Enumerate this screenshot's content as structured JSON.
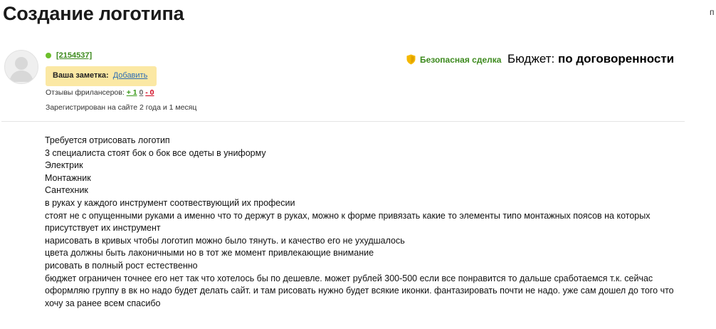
{
  "page": {
    "title": "Создание логотипа",
    "edge_text": "п"
  },
  "author": {
    "id_text": "[2154537]",
    "note_label": "Ваша заметка:",
    "note_link": "Добавить",
    "reviews_label": "Отзывы фрилансеров:",
    "reviews_positive": "+ 1",
    "reviews_neutral": "0",
    "reviews_negative": "- 0",
    "reviews_sep": "-",
    "registered": "Зарегистрирован на сайте 2 года и 1 месяц"
  },
  "deal": {
    "safe_deal_label": "Безопасная сделка",
    "budget_label": "Бюджет:",
    "budget_value": "по договоренности"
  },
  "description": {
    "lines": [
      "Требуется отрисовать логотип",
      "3 специалиста стоят бок о бок все одеты в униформу",
      "Электрик",
      "Монтажник",
      "Сантехник",
      "в руках у каждого инструмент соотвествующий их професии",
      "стоят не с опущенными руками а именно что то держут в руках, можно к форме привязать какие то элементы типо монтажных поясов на которых присутствует их инструмент",
      "нарисовать в кривых чтобы логотип можно было тянуть. и качество его не ухудшалось",
      "цвета должны быть лаконичными но в тот же момент привлекающие внимание",
      "рисовать в полный рост естественно",
      "бюджет ограничен точнее его нет так что хотелось бы по дешевле. может рублей 300-500 если все понравится то дальше сработаемся т.к. сейчас оформляю группу в вк но надо будет делать сайт. и там рисовать нужно будет всякие иконки. фантазировать почти не надо. уже сам дошел до того что хочу за ранее всем спасибо"
    ]
  },
  "colors": {
    "online": "#6cbf2c",
    "link_green": "#3d8a1e",
    "note_bg": "#fbe8a4",
    "shield": "#f5b800",
    "negative": "#d0021b"
  },
  "icons": {
    "avatar": "avatar-placeholder-icon",
    "safe_deal": "shield-icon",
    "online": "online-status-icon"
  }
}
